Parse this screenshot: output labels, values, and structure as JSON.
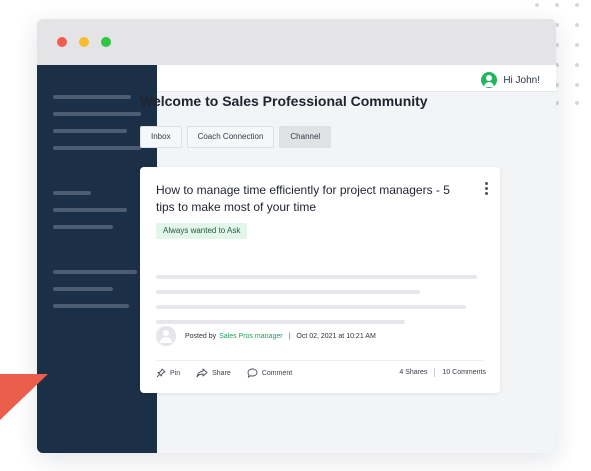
{
  "colors": {
    "sidebar": "#1b2f47",
    "accent_green": "#21b55f",
    "traffic_red": "#f05d50",
    "traffic_yellow": "#f8bc2f",
    "traffic_green": "#2cc841",
    "triangle": "#ec5e4c"
  },
  "header": {
    "greeting": "Hi John!",
    "user_icon": "user-avatar-icon"
  },
  "main": {
    "title": "Welcome to Sales Professional Community",
    "tabs": [
      {
        "label": "Inbox",
        "active": false
      },
      {
        "label": "Coach Connection",
        "active": false
      },
      {
        "label": "Channel",
        "active": true
      }
    ]
  },
  "post": {
    "title": "How to manage time efficiently for project managers - 5 tips to make most of your time",
    "tag": "Always wanted to Ask",
    "posted_by_prefix": "Posted by",
    "author": "Sales Pros manager",
    "separator": "|",
    "date": "Oct 02, 2021 at 10:21 AM",
    "actions": [
      {
        "label": "Pin",
        "icon": "pin-icon"
      },
      {
        "label": "Share",
        "icon": "share-icon"
      },
      {
        "label": "Comment",
        "icon": "comment-icon"
      }
    ],
    "shares": "4 Shares",
    "comments": "10 Comments"
  }
}
